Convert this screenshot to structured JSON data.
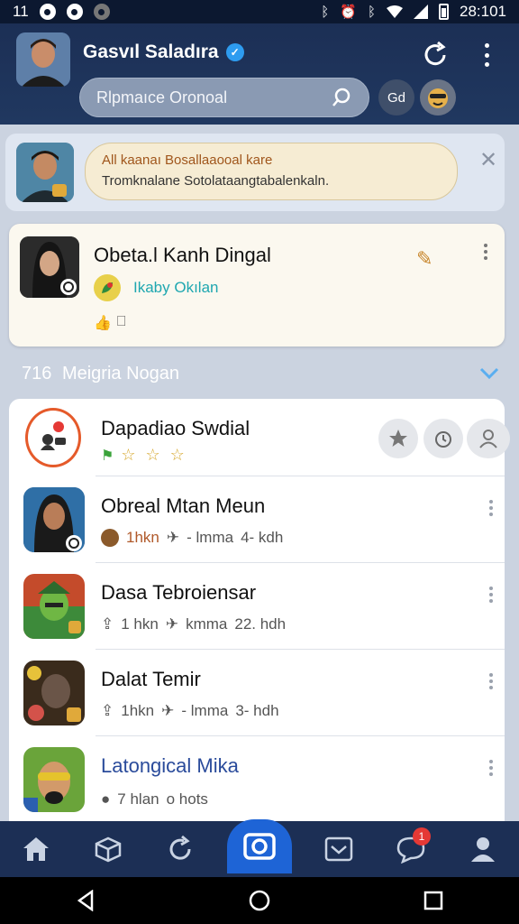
{
  "status_bar": {
    "left": "11",
    "time": "28:101"
  },
  "header": {
    "profile_name": "Gasvıl Saladıra",
    "search_placeholder": "Rlpmaıce Oronoal",
    "chip_label": "Gd"
  },
  "notice": {
    "title": "All kaanaı Bosallaaooal kare",
    "body": "Tromknalane Sotolataangtabalenkaln."
  },
  "featured": {
    "name": "Obeta.l Kanh Dingal",
    "subtitle": "Ikaby Okılan"
  },
  "section": {
    "number": "716",
    "title": "Meigria Nogan"
  },
  "list": [
    {
      "name": "Dapadiao Swdial",
      "stars": "☆ ☆ ☆"
    },
    {
      "name": "Obreal Mtan Meun",
      "meta_a": "1hkn",
      "meta_b": "- lmma",
      "meta_c": "4- kdh"
    },
    {
      "name": "Dasa Tebroiensar",
      "meta_a": "1 hkn",
      "meta_b": "kmma",
      "meta_c": "22. hdh"
    },
    {
      "name": "Dalat Temir",
      "meta_a": "1hkn",
      "meta_b": "- lmma",
      "meta_c": "3- hdh"
    },
    {
      "name": "Latongical Mika",
      "meta_a": "7 hlan",
      "meta_b": "o hots"
    }
  ],
  "bottom_nav": {
    "badge_count": "1"
  },
  "colors": {
    "header": "#1c2f55",
    "accent": "#1e64d6",
    "teal": "#1fa7b0",
    "badge": "#e53935"
  }
}
